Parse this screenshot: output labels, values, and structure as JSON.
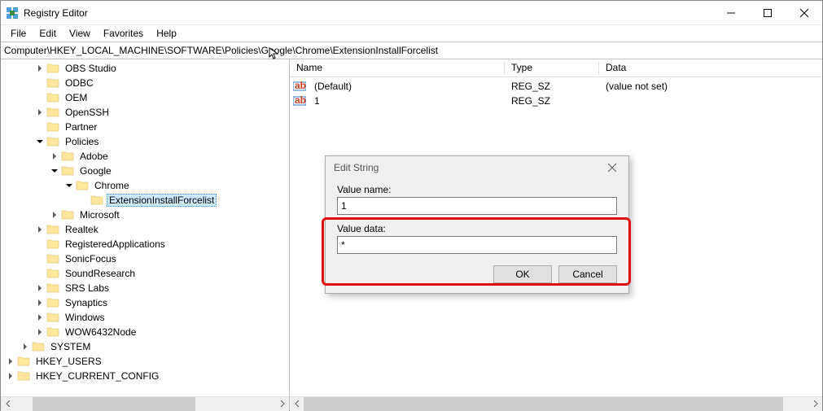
{
  "window": {
    "title": "Registry Editor"
  },
  "menu": [
    "File",
    "Edit",
    "View",
    "Favorites",
    "Help"
  ],
  "address": "Computer\\HKEY_LOCAL_MACHINE\\SOFTWARE\\Policies\\Google\\Chrome\\ExtensionInstallForcelist",
  "tree": [
    {
      "indent": 2,
      "exp": "closed",
      "label": "OBS Studio"
    },
    {
      "indent": 2,
      "exp": "none",
      "label": "ODBC"
    },
    {
      "indent": 2,
      "exp": "none",
      "label": "OEM"
    },
    {
      "indent": 2,
      "exp": "closed",
      "label": "OpenSSH"
    },
    {
      "indent": 2,
      "exp": "none",
      "label": "Partner"
    },
    {
      "indent": 2,
      "exp": "open",
      "label": "Policies"
    },
    {
      "indent": 3,
      "exp": "closed",
      "label": "Adobe"
    },
    {
      "indent": 3,
      "exp": "open",
      "label": "Google"
    },
    {
      "indent": 4,
      "exp": "open",
      "label": "Chrome"
    },
    {
      "indent": 5,
      "exp": "none",
      "label": "ExtensionInstallForcelist",
      "selected": true
    },
    {
      "indent": 3,
      "exp": "closed",
      "label": "Microsoft"
    },
    {
      "indent": 2,
      "exp": "closed",
      "label": "Realtek"
    },
    {
      "indent": 2,
      "exp": "none",
      "label": "RegisteredApplications"
    },
    {
      "indent": 2,
      "exp": "none",
      "label": "SonicFocus"
    },
    {
      "indent": 2,
      "exp": "none",
      "label": "SoundResearch"
    },
    {
      "indent": 2,
      "exp": "closed",
      "label": "SRS Labs"
    },
    {
      "indent": 2,
      "exp": "closed",
      "label": "Synaptics"
    },
    {
      "indent": 2,
      "exp": "closed",
      "label": "Windows"
    },
    {
      "indent": 2,
      "exp": "closed",
      "label": "WOW6432Node"
    },
    {
      "indent": 1,
      "exp": "closed",
      "label": "SYSTEM"
    },
    {
      "indent": 0,
      "exp": "closed",
      "label": "HKEY_USERS"
    },
    {
      "indent": 0,
      "exp": "closed",
      "label": "HKEY_CURRENT_CONFIG"
    }
  ],
  "columns": {
    "name": "Name",
    "type": "Type",
    "data": "Data"
  },
  "rows": [
    {
      "name": "(Default)",
      "type": "REG_SZ",
      "data": "(value not set)"
    },
    {
      "name": "1",
      "type": "REG_SZ",
      "data": ""
    }
  ],
  "dialog": {
    "title": "Edit String",
    "value_name_label": "Value name:",
    "value_name": "1",
    "value_data_label": "Value data:",
    "value_data": "*",
    "ok": "OK",
    "cancel": "Cancel"
  }
}
